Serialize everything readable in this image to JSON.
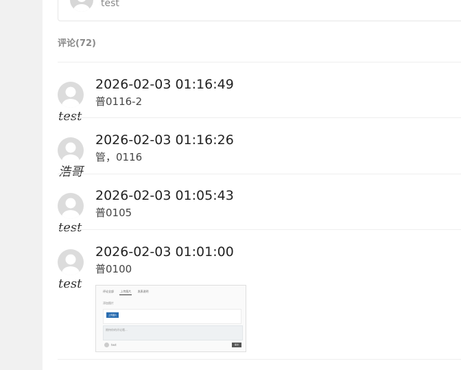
{
  "top_card": {
    "name": "test"
  },
  "comments_section": {
    "title": "评论(72)",
    "comments": [
      {
        "author": "test",
        "time": "2026-02-03 01:16:49",
        "text": "普0116-2"
      },
      {
        "author": "浩哥",
        "time": "2026-02-03 01:16:26",
        "text": "管，0116"
      },
      {
        "author": "test",
        "time": "2026-02-03 01:05:43",
        "text": "普0105"
      },
      {
        "author": "test",
        "time": "2026-02-03 01:01:00",
        "text": "普0100"
      }
    ]
  },
  "attachment_preview": {
    "tabs": [
      "评论全部",
      "上传图片",
      "发表说明"
    ],
    "field_label": "添加图片",
    "upload_button": "上传图片",
    "textarea_placeholder": "期待你的评论哦...",
    "user_name": "test",
    "submit_label": "提交"
  }
}
